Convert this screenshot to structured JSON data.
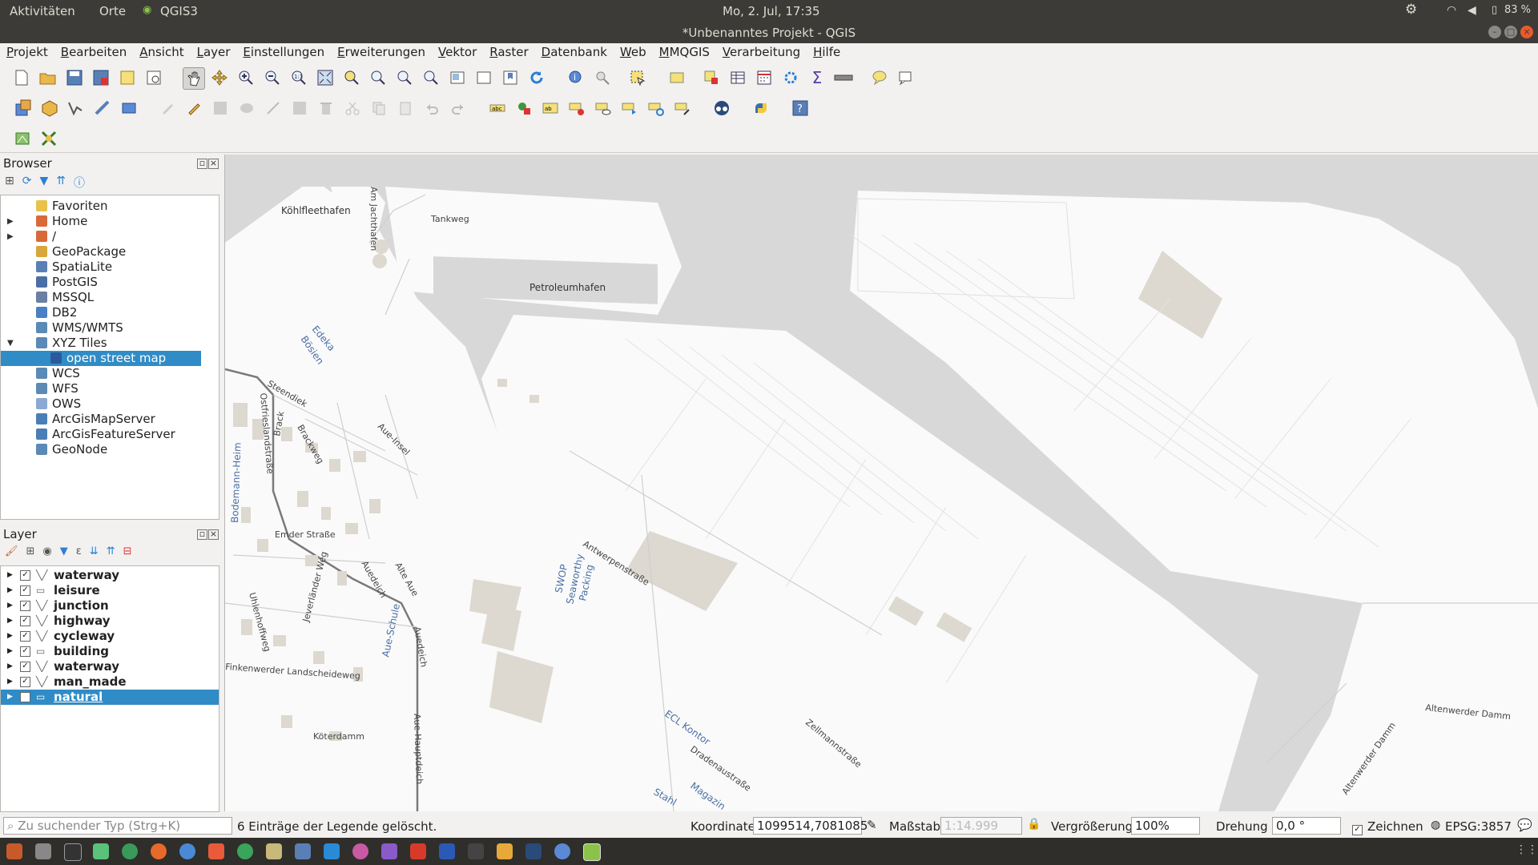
{
  "system_bar": {
    "activities": "Aktivitäten",
    "places": "Orte",
    "app": "QGIS3",
    "clock": "Mo,  2. Jul, 17:35",
    "battery": "83 %"
  },
  "window": {
    "title": "*Unbenanntes Projekt - QGIS"
  },
  "menu": [
    "Projekt",
    "Bearbeiten",
    "Ansicht",
    "Layer",
    "Einstellungen",
    "Erweiterungen",
    "Vektor",
    "Raster",
    "Datenbank",
    "Web",
    "MMQGIS",
    "Verarbeitung",
    "Hilfe"
  ],
  "browser": {
    "title": "Browser",
    "items": [
      {
        "label": "Favoriten",
        "icon": "star-icon",
        "color": "#e8c24a"
      },
      {
        "label": "Home",
        "icon": "folder-icon",
        "color": "#d86a3a"
      },
      {
        "label": "/",
        "icon": "folder-icon",
        "color": "#d86a3a"
      },
      {
        "label": "GeoPackage",
        "icon": "geopackage-icon",
        "color": "#d8a63a"
      },
      {
        "label": "SpatiaLite",
        "icon": "spatialite-icon",
        "color": "#5a7fb5"
      },
      {
        "label": "PostGIS",
        "icon": "postgis-icon",
        "color": "#4a6fa5"
      },
      {
        "label": "MSSQL",
        "icon": "mssql-icon",
        "color": "#6b7fa3"
      },
      {
        "label": "DB2",
        "icon": "db2-icon",
        "color": "#4a7fc5"
      },
      {
        "label": "WMS/WMTS",
        "icon": "globe-icon",
        "color": "#5a8ab5"
      },
      {
        "label": "XYZ Tiles",
        "icon": "xyz-icon",
        "color": "#5a8ab5"
      },
      {
        "label": "open street map",
        "icon": "tiles-icon",
        "color": "#2a5a9a"
      },
      {
        "label": "WCS",
        "icon": "globe-icon",
        "color": "#5a8ab5"
      },
      {
        "label": "WFS",
        "icon": "globe-icon",
        "color": "#5a8ab5"
      },
      {
        "label": "OWS",
        "icon": "globe-icon",
        "color": "#8aaad5"
      },
      {
        "label": "ArcGisMapServer",
        "icon": "arcgis-icon",
        "color": "#4a7fb5"
      },
      {
        "label": "ArcGisFeatureServer",
        "icon": "arcgis-icon",
        "color": "#4a7fb5"
      },
      {
        "label": "GeoNode",
        "icon": "geonode-icon",
        "color": "#5a8ab5"
      }
    ]
  },
  "layers": {
    "title": "Layer",
    "items": [
      {
        "label": "waterway",
        "type": "line"
      },
      {
        "label": "leisure",
        "type": "polygon"
      },
      {
        "label": "junction",
        "type": "line"
      },
      {
        "label": "highway",
        "type": "line"
      },
      {
        "label": "cycleway",
        "type": "line"
      },
      {
        "label": "building",
        "type": "polygon"
      },
      {
        "label": "waterway",
        "type": "line"
      },
      {
        "label": "man_made",
        "type": "line"
      },
      {
        "label": "natural",
        "type": "polygon"
      }
    ]
  },
  "map": {
    "labels": {
      "koehlfleethafen": "Köhlfleethafen",
      "petroleumhafen": "Petroleumhafen",
      "tankweg": "Tankweg",
      "am_jachthafen": "Am Jachthafen",
      "edeka": "Edeka",
      "boesen": "Bösien",
      "steendiek": "Steendiek",
      "ostfrieslandstrasse": "Ostfrieslandstraße",
      "brackweg": "Brackweg",
      "brack": "Brack",
      "aue_insel": "Aue-Insel",
      "emder_strasse": "Emder Straße",
      "bodemann_heim": "Bodemann-Heim",
      "auedeich": "Auedeich",
      "alte_aue": "Alte Aue",
      "jeverlaender_weg": "Jeverländer Weg",
      "aue_schule": "Aue-Schule",
      "auedeich2": "Auedeich",
      "uhlenhoffweg": "Uhlenhoffweg",
      "finkenwerder_landscheideweg": "Finkenwerder Landscheideweg",
      "koeterdamm": "Köterdamm",
      "aue_hauptdeich": "Aue-Hauptdeich",
      "antwerpenstrasse": "Antwerpenstraße",
      "swop": "SWOP",
      "seaworthy": "Seaworthy",
      "packing": "Packing",
      "ecl_kontor": "ECL Kontor",
      "dradenaustrasse": "Dradenaustraße",
      "magazin": "Magazin",
      "stahl": "Stahl",
      "zellmannstrasse": "Zellmannstraße",
      "altenwerder_damm": "Altenwerder Damm",
      "altenwerder_damm2": "Altenwerder Damm"
    }
  },
  "statusbar": {
    "search_placeholder": "Zu suchender Typ (Strg+K)",
    "message": "6 Einträge der Legende gelöscht.",
    "coord_label": "Koordinate",
    "coord_value": "1099514,7081085",
    "scale_label": "Maßstab",
    "scale_value": "1:14.999",
    "magnifier_label": "Vergrößerung",
    "magnifier_value": "100%",
    "rotation_label": "Drehung",
    "rotation_value": "0,0 °",
    "render_label": "Zeichnen",
    "crs": "EPSG:3857"
  }
}
